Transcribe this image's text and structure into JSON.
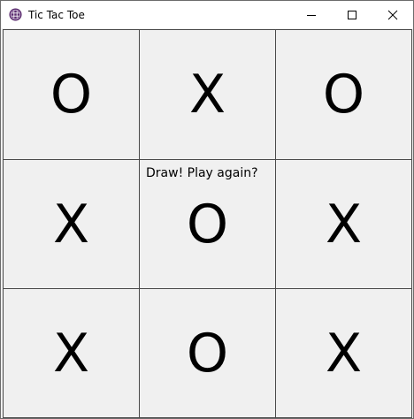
{
  "window": {
    "title": "Tic Tac Toe",
    "icon": "game-app-icon",
    "controls": {
      "minimize_icon": "minimize-icon",
      "maximize_icon": "maximize-icon",
      "close_icon": "close-icon"
    }
  },
  "board": {
    "cells": [
      [
        "O",
        "X",
        "O"
      ],
      [
        "X",
        "O",
        "X"
      ],
      [
        "X",
        "O",
        "X"
      ]
    ]
  },
  "status": {
    "message": "Draw! Play again?"
  },
  "colors": {
    "titlebar": "#ffffff",
    "cell_background": "#f0f0f0",
    "grid_line": "#4a4a4a",
    "icon_accent": "#5b2c6f"
  }
}
